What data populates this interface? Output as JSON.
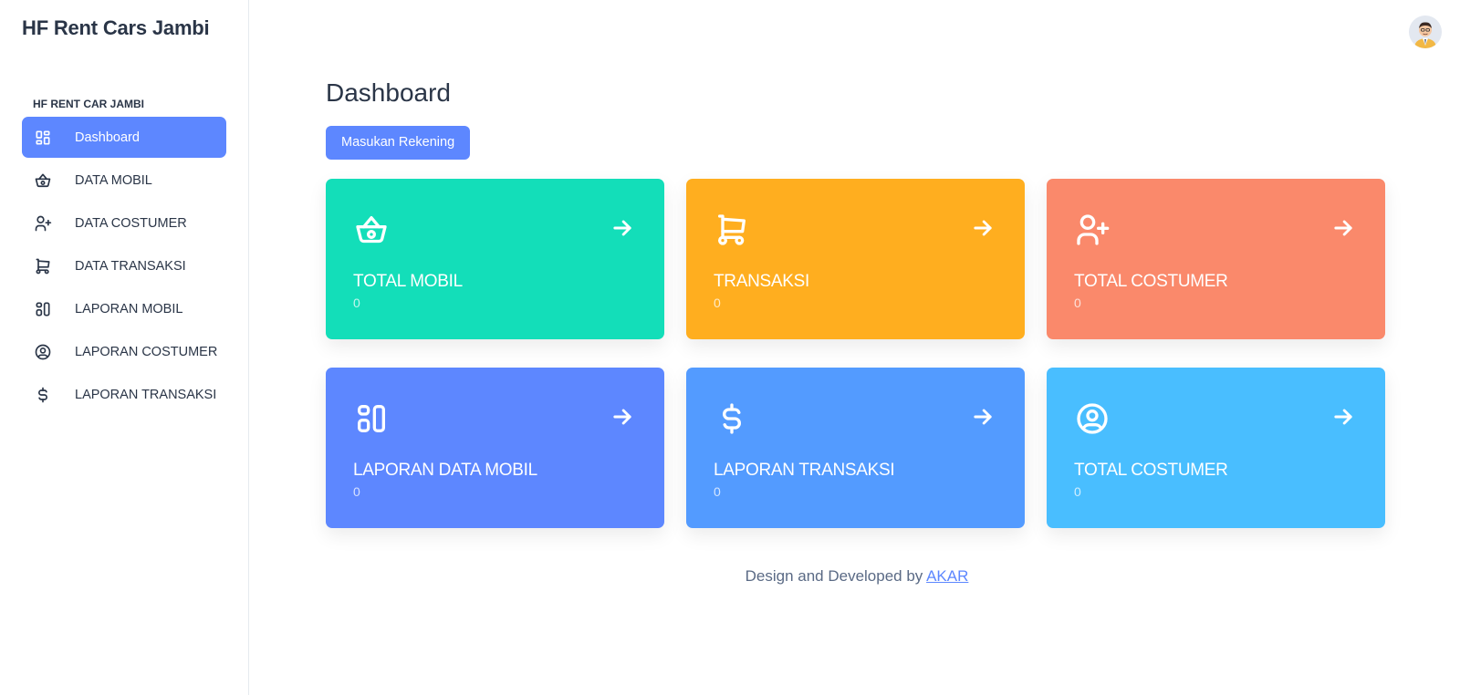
{
  "brand": "HF Rent Cars Jambi",
  "sidebar": {
    "caption": "HF RENT CAR JAMBI",
    "items": [
      {
        "label": "Dashboard",
        "icon": "dashboard-icon"
      },
      {
        "label": "DATA MOBIL",
        "icon": "basket-icon"
      },
      {
        "label": "DATA COSTUMER",
        "icon": "user-plus-icon"
      },
      {
        "label": "DATA TRANSAKSI",
        "icon": "cart-icon"
      },
      {
        "label": "LAPORAN MOBIL",
        "icon": "layout-columns-icon"
      },
      {
        "label": "LAPORAN COSTUMER",
        "icon": "user-circle-icon"
      },
      {
        "label": "LAPORAN TRANSAKSI",
        "icon": "dollar-icon"
      }
    ]
  },
  "header": {
    "avatar": "avatar"
  },
  "main": {
    "title": "Dashboard",
    "button_label": "Masukan Rekening",
    "cards": [
      {
        "title": "TOTAL MOBIL",
        "value": "0",
        "color": "#13deb9",
        "icon": "basket-icon"
      },
      {
        "title": "TRANSAKSI",
        "value": "0",
        "color": "#ffae1f",
        "icon": "cart-icon"
      },
      {
        "title": "TOTAL COSTUMER",
        "value": "0",
        "color": "#fa896b",
        "icon": "user-plus-icon"
      },
      {
        "title": "LAPORAN DATA MOBIL",
        "value": "0",
        "color": "#5d87ff",
        "icon": "layout-columns-icon"
      },
      {
        "title": "LAPORAN TRANSAKSI",
        "value": "0",
        "color": "#539bff",
        "icon": "dollar-icon"
      },
      {
        "title": "TOTAL COSTUMER",
        "value": "0",
        "color": "#49beff",
        "icon": "user-circle-icon"
      }
    ]
  },
  "footer": {
    "text": "Design and Developed by ",
    "link": "AKAR"
  }
}
